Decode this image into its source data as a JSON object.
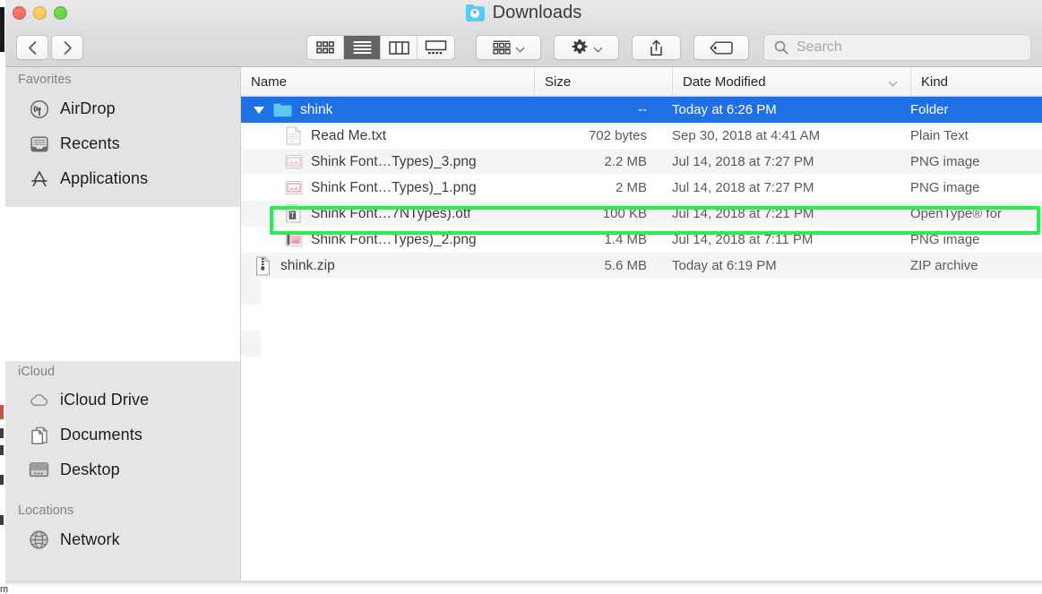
{
  "window": {
    "title": "Downloads",
    "title_icon": "downloads-folder-icon",
    "traffic_lights": {
      "close": "close-window-button",
      "minimize": "minimize-window-button",
      "maximize": "maximize-window-button"
    }
  },
  "toolbar": {
    "back_label": "Back",
    "forward_label": "Forward",
    "views": [
      {
        "id": "icon-view",
        "label": "Icon View",
        "active": false
      },
      {
        "id": "list-view",
        "label": "List View",
        "active": true
      },
      {
        "id": "column-view",
        "label": "Column View",
        "active": false
      },
      {
        "id": "gallery-view",
        "label": "Gallery View",
        "active": false
      }
    ],
    "group_label": "Group",
    "action_label": "Action",
    "share_label": "Share",
    "tags_label": "Tags"
  },
  "search": {
    "placeholder": "Search",
    "value": "",
    "icon": "search-icon"
  },
  "sidebar": {
    "sections": [
      {
        "header": "Favorites",
        "items": [
          {
            "label": "AirDrop",
            "icon": "airdrop-icon"
          },
          {
            "label": "Recents",
            "icon": "recents-clock-icon"
          },
          {
            "label": "Applications",
            "icon": "applications-icon"
          }
        ]
      },
      {
        "header": "iCloud",
        "items": [
          {
            "label": "iCloud Drive",
            "icon": "icloud-drive-icon"
          },
          {
            "label": "Documents",
            "icon": "documents-icon"
          },
          {
            "label": "Desktop",
            "icon": "desktop-icon"
          }
        ]
      },
      {
        "header": "Locations",
        "items": [
          {
            "label": "Network",
            "icon": "network-globe-icon"
          }
        ]
      }
    ]
  },
  "file_list": {
    "columns": [
      {
        "key": "name",
        "label": "Name"
      },
      {
        "key": "size",
        "label": "Size"
      },
      {
        "key": "date",
        "label": "Date Modified",
        "sorted": true,
        "sort_icon": "chevron-down-icon"
      },
      {
        "key": "kind",
        "label": "Kind"
      }
    ],
    "rows": [
      {
        "name": "shink",
        "size": "--",
        "date": "Today at 6:26 PM",
        "kind": "Folder",
        "icon": "folder-icon",
        "indent": 0,
        "selected": true,
        "expanded": true,
        "highlighted": false
      },
      {
        "name": "Read Me.txt",
        "size": "702 bytes",
        "date": "Sep 30, 2018 at 4:41 AM",
        "kind": "Plain Text",
        "icon": "text-document-icon",
        "indent": 1,
        "selected": false,
        "highlighted": false
      },
      {
        "name": "Shink Font…Types)_3.png",
        "size": "2.2 MB",
        "date": "Jul 14, 2018 at 7:27 PM",
        "kind": "PNG image",
        "icon": "png-image-icon",
        "indent": 1,
        "selected": false,
        "highlighted": false
      },
      {
        "name": "Shink Font…Types)_1.png",
        "size": "2 MB",
        "date": "Jul 14, 2018 at 7:27 PM",
        "kind": "PNG image",
        "icon": "png-image-icon",
        "indent": 1,
        "selected": false,
        "highlighted": false
      },
      {
        "name": "Shink Font…7NTypes).otf",
        "size": "100 KB",
        "date": "Jul 14, 2018 at 7:21 PM",
        "kind": "OpenType® for",
        "icon": "font-file-icon",
        "indent": 1,
        "selected": false,
        "highlighted": true
      },
      {
        "name": "Shink Font…Types)_2.png",
        "size": "1.4 MB",
        "date": "Jul 14, 2018 at 7:11 PM",
        "kind": "PNG image",
        "icon": "png-image-icon",
        "indent": 1,
        "selected": false,
        "highlighted": false
      },
      {
        "name": "shink.zip",
        "size": "5.6 MB",
        "date": "Today at 6:19 PM",
        "kind": "ZIP archive",
        "icon": "zip-archive-icon",
        "indent": 0,
        "selected": false,
        "highlighted": false
      }
    ]
  },
  "annotation": {
    "color": "#2aee4f",
    "target_row": "Shink Font…7NTypes).otf"
  },
  "background_fragment": {
    "text": "m"
  },
  "colors": {
    "selection_blue": "#1f6fe5",
    "highlight_green": "#2aee4f",
    "sidebar_bg": "#e4e3e3",
    "titlebar_bg": "#dedede",
    "stripe": "#f5f5f5"
  }
}
